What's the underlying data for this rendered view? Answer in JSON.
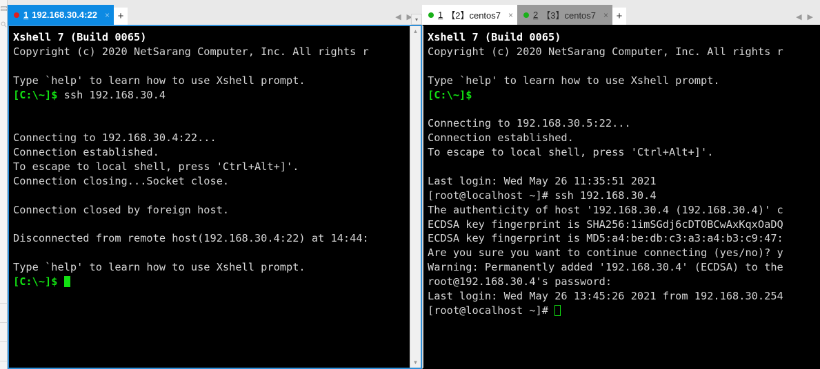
{
  "window": {
    "title": "Xshell 7",
    "strip": {
      "icons": [
        "session-manager-icon",
        "search-icon"
      ]
    }
  },
  "left_pane": {
    "tabs": [
      {
        "number": "1",
        "title": "192.168.30.4:22",
        "status_dot_color": "#e02020",
        "state": "active-blue",
        "close_label": "×"
      }
    ],
    "add_tab_label": "+",
    "nav_prev": "◀",
    "nav_next": "▶",
    "scrollbar": {
      "up_arrow": "⌃",
      "down_arrow": "⌄"
    },
    "terminal": {
      "lines": [
        {
          "type": "text",
          "bold": true,
          "text": "Xshell 7 (Build 0065)"
        },
        {
          "type": "text",
          "text": "Copyright (c) 2020 NetSarang Computer, Inc. All rights r"
        },
        {
          "type": "blank"
        },
        {
          "type": "text",
          "text": "Type `help' to learn how to use Xshell prompt."
        },
        {
          "type": "prompt",
          "prompt": "[C:\\~]$",
          "text": " ssh 192.168.30.4"
        },
        {
          "type": "blank"
        },
        {
          "type": "blank"
        },
        {
          "type": "text",
          "text": "Connecting to 192.168.30.4:22..."
        },
        {
          "type": "text",
          "text": "Connection established."
        },
        {
          "type": "text",
          "text": "To escape to local shell, press 'Ctrl+Alt+]'."
        },
        {
          "type": "text",
          "text": "Connection closing...Socket close."
        },
        {
          "type": "blank"
        },
        {
          "type": "text",
          "text": "Connection closed by foreign host."
        },
        {
          "type": "blank"
        },
        {
          "type": "text",
          "text": "Disconnected from remote host(192.168.30.4:22) at 14:44:"
        },
        {
          "type": "blank"
        },
        {
          "type": "text",
          "text": "Type `help' to learn how to use Xshell prompt."
        },
        {
          "type": "prompt-cursor",
          "prompt": "[C:\\~]$",
          "text": " ",
          "cursor": "solid"
        }
      ]
    }
  },
  "right_pane": {
    "tabs": [
      {
        "number": "1",
        "title": "【2】centos7",
        "status_dot_color": "#19b019",
        "state": "active-white",
        "close_label": "×"
      },
      {
        "number": "2",
        "title": "【3】centos7",
        "status_dot_color": "#19b019",
        "state": "inactive-grey",
        "close_label": "×"
      }
    ],
    "add_tab_label": "+",
    "nav_prev": "◀",
    "nav_next": "▶",
    "terminal": {
      "lines": [
        {
          "type": "text",
          "bold": true,
          "text": "Xshell 7 (Build 0065)"
        },
        {
          "type": "text",
          "text": "Copyright (c) 2020 NetSarang Computer, Inc. All rights r"
        },
        {
          "type": "blank"
        },
        {
          "type": "text",
          "text": "Type `help' to learn how to use Xshell prompt."
        },
        {
          "type": "prompt",
          "prompt": "[C:\\~]$",
          "text": ""
        },
        {
          "type": "blank"
        },
        {
          "type": "text",
          "text": "Connecting to 192.168.30.5:22..."
        },
        {
          "type": "text",
          "text": "Connection established."
        },
        {
          "type": "text",
          "text": "To escape to local shell, press 'Ctrl+Alt+]'."
        },
        {
          "type": "blank"
        },
        {
          "type": "text",
          "text": "Last login: Wed May 26 11:35:51 2021"
        },
        {
          "type": "text",
          "text": "[root@localhost ~]# ssh 192.168.30.4"
        },
        {
          "type": "text",
          "text": "The authenticity of host '192.168.30.4 (192.168.30.4)' c"
        },
        {
          "type": "text",
          "text": "ECDSA key fingerprint is SHA256:1imSGdj6cDTOBCwAxKqxOaDQ"
        },
        {
          "type": "text",
          "text": "ECDSA key fingerprint is MD5:a4:be:db:c3:a3:a4:b3:c9:47:"
        },
        {
          "type": "text",
          "text": "Are you sure you want to continue connecting (yes/no)? y"
        },
        {
          "type": "text",
          "text": "Warning: Permanently added '192.168.30.4' (ECDSA) to the"
        },
        {
          "type": "text",
          "text": "root@192.168.30.4's password:"
        },
        {
          "type": "text",
          "text": "Last login: Wed May 26 13:45:26 2021 from 192.168.30.254"
        },
        {
          "type": "prompt-cursor",
          "prompt": "",
          "text": "[root@localhost ~]# ",
          "cursor": "hollow"
        }
      ]
    }
  }
}
